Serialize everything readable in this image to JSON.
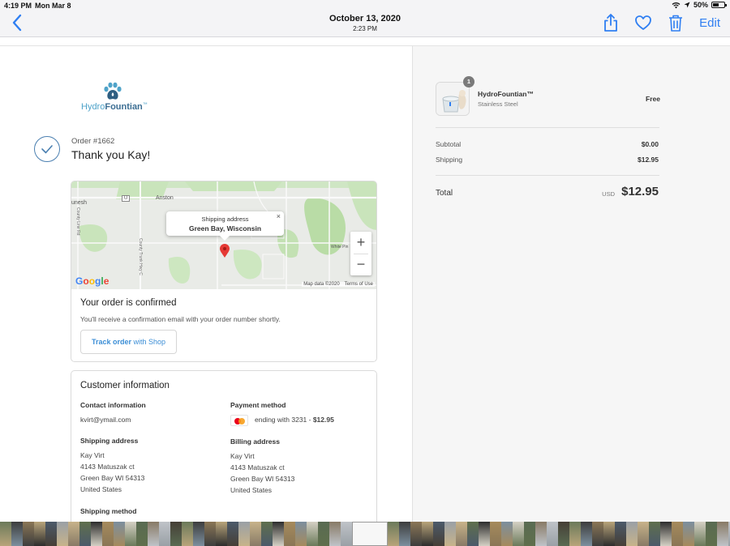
{
  "status_bar": {
    "time": "4:19 PM",
    "date": "Mon Mar 8",
    "battery": "50%"
  },
  "nav": {
    "title": "October 13, 2020",
    "subtitle": "2:23 PM",
    "edit_label": "Edit"
  },
  "store": {
    "logo_first": "Hydro",
    "logo_second": "Fountian",
    "logo_tm": "™"
  },
  "order": {
    "number": "Order #1662",
    "thanks": "Thank you Kay!"
  },
  "map": {
    "popup_label": "Shipping address",
    "popup_city": "Green Bay, Wisconsin",
    "close": "×",
    "zoom_in": "+",
    "zoom_out": "−",
    "map_data": "Map data ©2020",
    "terms": "Terms of Use",
    "labels": {
      "anston": "Anston",
      "unesh": "unesh",
      "white_pine": "White Pin",
      "county_rd": "County Line Rd",
      "county_trunk": "County Trunk Hwy C",
      "route": "U"
    },
    "pin_color": "#e53935"
  },
  "confirmation": {
    "title": "Your order is confirmed",
    "text": "You'll receive a confirmation email with your order number shortly.",
    "track_strong": "Track order",
    "track_rest": " with Shop"
  },
  "customer": {
    "title": "Customer information",
    "contact_h": "Contact information",
    "contact_v": "kvirt@ymail.com",
    "payment_h": "Payment method",
    "payment_v": "ending with 3231 - ",
    "payment_amount": "$12.95",
    "shipping_h": "Shipping address",
    "shipping_lines": [
      "Kay Virt",
      "4143 Matuszak ct",
      "Green Bay WI 54313",
      "United States"
    ],
    "billing_h": "Billing address",
    "billing_lines": [
      "Kay Virt",
      "4143 Matuszak ct",
      "Green Bay WI 54313",
      "United States"
    ],
    "method_h": "Shipping method"
  },
  "summary": {
    "qty": "1",
    "product_name": "HydroFountian™",
    "product_variant": "Stainless Steel",
    "product_price": "Free",
    "subtotal_l": "Subtotal",
    "subtotal_v": "$0.00",
    "shipping_l": "Shipping",
    "shipping_v": "$12.95",
    "total_l": "Total",
    "total_currency": "USD",
    "total_v": "$12.95"
  },
  "colors": {
    "accent": "#2f7ff2",
    "link": "#3b8ed6",
    "map_green": "#c5e3b7"
  }
}
